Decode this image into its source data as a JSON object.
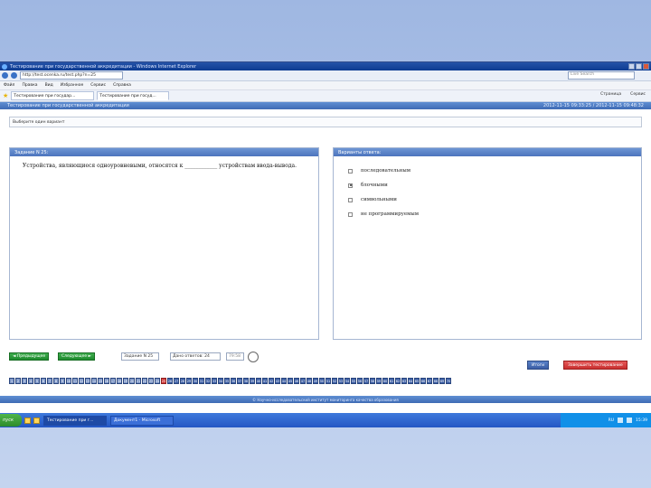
{
  "browser": {
    "window_title": "Тестирование при государственной аккредитации - Windows Internet Explorer",
    "url": "http://test.ocenka.ru/test.php?n=25",
    "search_placeholder": "Live Search",
    "menu": [
      "Файл",
      "Правка",
      "Вид",
      "Избранное",
      "Сервис",
      "Справка"
    ],
    "tabs": [
      {
        "label": "Тестирование при государ..."
      },
      {
        "label": "Тестирование при госуд..."
      }
    ],
    "tools": [
      "Страница",
      "Сервис"
    ]
  },
  "app": {
    "header_title": "Тестирование при государственной аккредитации",
    "header_meta": "2012-11-15 09:33:25 / 2012-11-15 09:48:32",
    "notice": "Выберите один вариант"
  },
  "question": {
    "panel_title": "Задание N 25:",
    "text": "Устройства, являющиеся одноуровневыми, относятся к ____________ устройствам ввода-вывода."
  },
  "answers": {
    "panel_title": "Варианты ответа:",
    "options": [
      {
        "label": "последовательным",
        "checked": false
      },
      {
        "label": "блочными",
        "checked": true
      },
      {
        "label": "символьными",
        "checked": false
      },
      {
        "label": "не программируемым",
        "checked": false
      }
    ]
  },
  "nav": {
    "prev": "◄ Предыдущее",
    "next": "Следующее ►",
    "task_info": "Задание N 25",
    "answered_info": "Дано ответов: 24",
    "timer": "79:58",
    "finish": "Итоги",
    "end_test": "Завершить тестирование"
  },
  "question_numbers": [
    "1",
    "2",
    "3",
    "4",
    "5",
    "6",
    "7",
    "8",
    "9",
    "10",
    "11",
    "12",
    "13",
    "14",
    "15",
    "16",
    "17",
    "18",
    "19",
    "20",
    "21",
    "22",
    "23",
    "24",
    "25",
    "26",
    "27",
    "28",
    "29",
    "30",
    "31",
    "32",
    "33",
    "34",
    "35",
    "36",
    "37",
    "38",
    "39",
    "40",
    "41",
    "42",
    "43",
    "44",
    "45",
    "46",
    "47",
    "48",
    "49",
    "50",
    "51",
    "52",
    "53",
    "54",
    "55",
    "56",
    "57",
    "58",
    "59",
    "60",
    "61",
    "62",
    "63",
    "64",
    "65",
    "66",
    "67",
    "68",
    "69",
    "70"
  ],
  "current_question": "25",
  "footer": "© Научно-исследовательский институт мониторинга качества образования",
  "taskbar": {
    "start": "пуск",
    "tasks": [
      "Тестирование при г...",
      "Документ1 - Microsoft"
    ],
    "language": "RU",
    "clock": "15:39"
  },
  "colors": {
    "accent": "#3f6bb4",
    "next_green": "#2c9a3a",
    "current_red": "#d33b3b"
  }
}
